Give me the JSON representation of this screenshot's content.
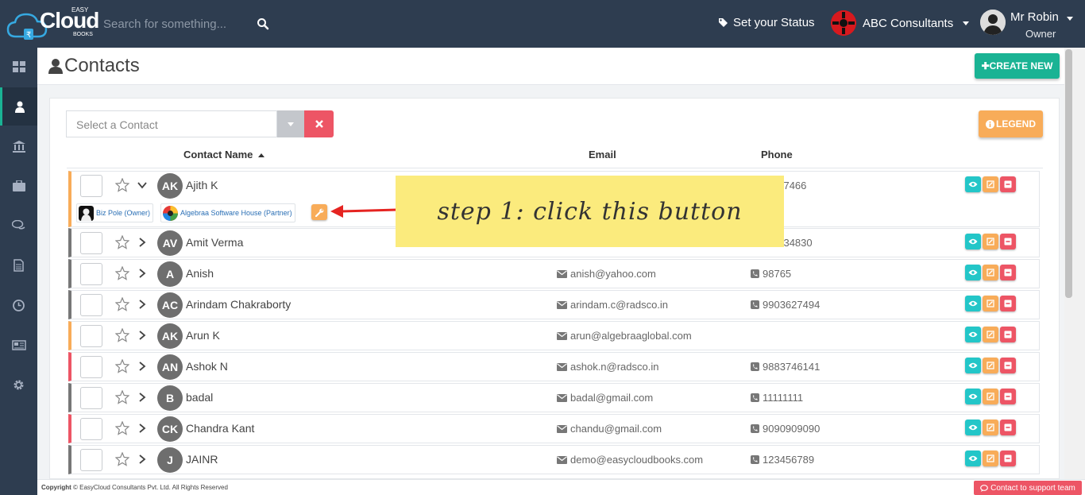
{
  "brand": {
    "name": "Cloud",
    "easy": "EASY",
    "books": "BOOKS"
  },
  "search": {
    "placeholder": "Search for something..."
  },
  "header": {
    "status_label": "Set your Status",
    "company_name": "ABC Consultants",
    "user_name": "Mr Robin",
    "user_role": "Owner"
  },
  "page": {
    "title": "Contacts",
    "create_label": "CREATE NEW",
    "legend_label": "LEGEND",
    "select_placeholder": "Select a Contact"
  },
  "columns": {
    "name": "Contact Name",
    "email": "Email",
    "phone": "Phone"
  },
  "expanded": {
    "companies": [
      {
        "label": "Biz Pole (Owner)"
      },
      {
        "label": "Algebraa Software House (Partner)"
      }
    ]
  },
  "rows": [
    {
      "initials": "AK",
      "name": "Ajith K",
      "email": "",
      "phone": "017466",
      "border": "#f8ac59",
      "expanded": true
    },
    {
      "initials": "AV",
      "name": "Amit Verma",
      "email": "",
      "phone": "7334830",
      "border": "#777777",
      "expanded": false
    },
    {
      "initials": "A",
      "name": "Anish",
      "email": "anish@yahoo.com",
      "phone": "98765",
      "border": "#777777",
      "expanded": false
    },
    {
      "initials": "AC",
      "name": "Arindam Chakraborty",
      "email": "arindam.c@radsco.in",
      "phone": "9903627494",
      "border": "#777777",
      "expanded": false
    },
    {
      "initials": "AK",
      "name": "Arun K",
      "email": "arun@algebraaglobal.com",
      "phone": "",
      "border": "#f8ac59",
      "expanded": false
    },
    {
      "initials": "AN",
      "name": "Ashok N",
      "email": "ashok.n@radsco.in",
      "phone": "9883746141",
      "border": "#ed5565",
      "expanded": false
    },
    {
      "initials": "B",
      "name": "badal",
      "email": "badal@gmail.com",
      "phone": "11111111",
      "border": "#777777",
      "expanded": false
    },
    {
      "initials": "CK",
      "name": "Chandra Kant",
      "email": "chandu@gmail.com",
      "phone": "9090909090",
      "border": "#ed5565",
      "expanded": false
    },
    {
      "initials": "J",
      "name": "JAINR",
      "email": "demo@easycloudbooks.com",
      "phone": "123456789",
      "border": "#777777",
      "expanded": false
    }
  ],
  "annotation": {
    "text": "step 1: click this button"
  },
  "footer": {
    "copyright_bold": "Copyright",
    "copyright_text": "© EasyCloud Consultants Pvt. Ltd. All Rights Reserved",
    "support_label": "Contact to support team"
  },
  "colors": {
    "topbar": "#2e3d50",
    "primary": "#1ab394",
    "warning": "#f8ac59",
    "danger": "#ed5565",
    "info": "#23c6c8"
  }
}
